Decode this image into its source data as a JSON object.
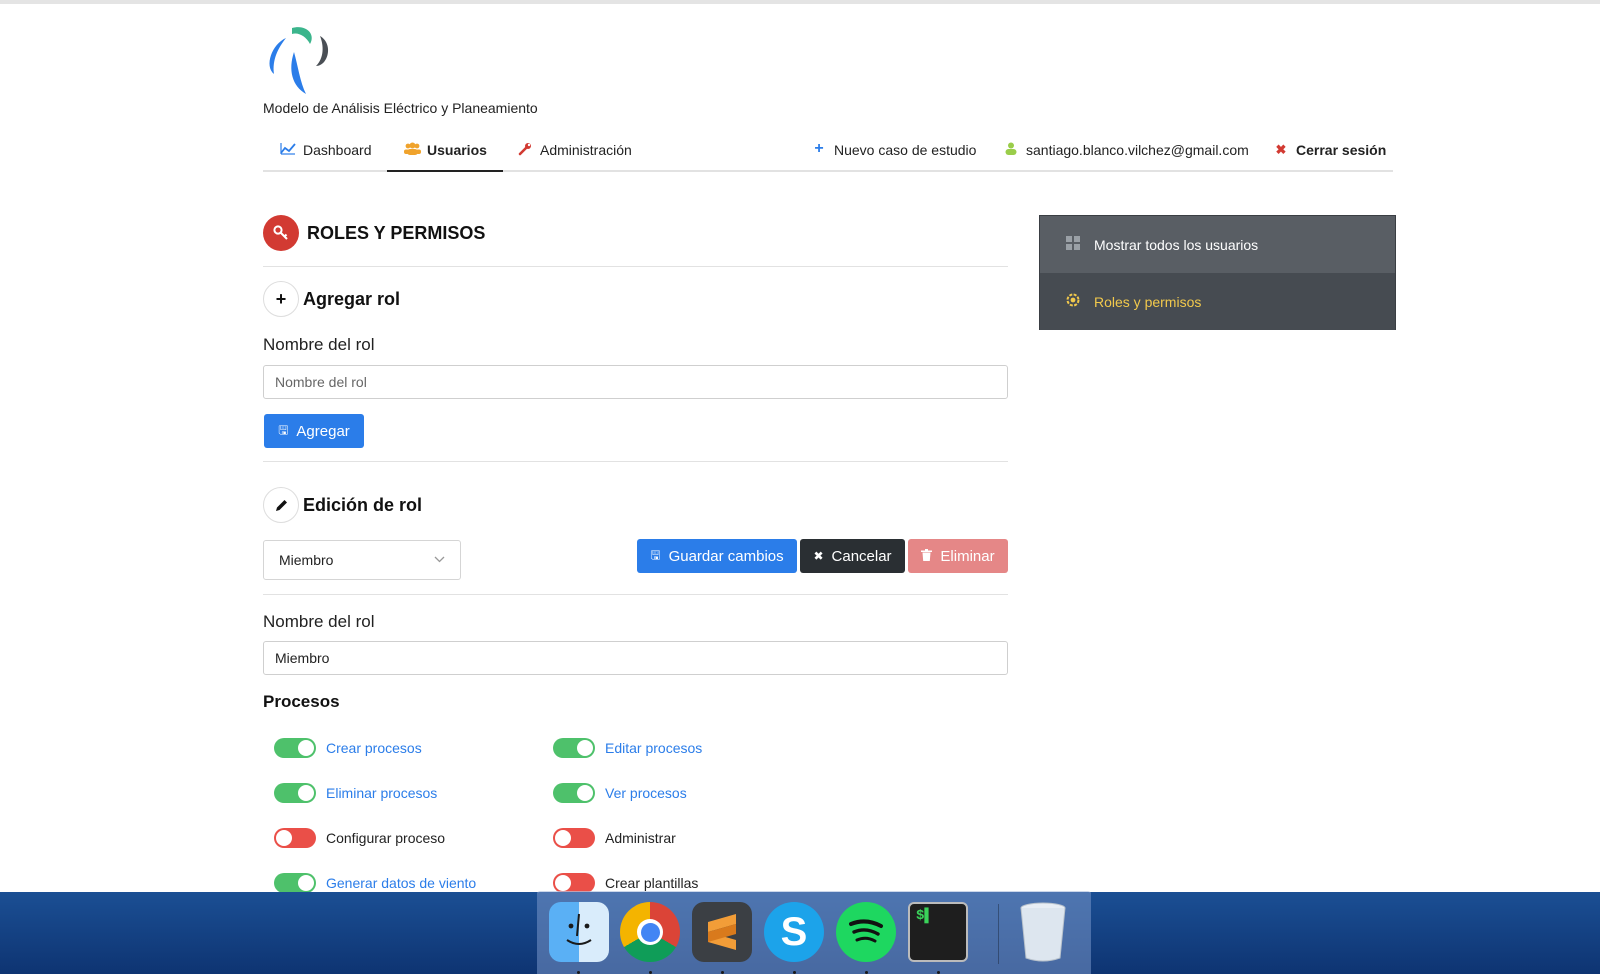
{
  "app": {
    "title": "Modelo de Análisis Eléctrico y Planeamiento"
  },
  "nav": {
    "dashboard": "Dashboard",
    "usuarios": "Usuarios",
    "administracion": "Administración",
    "nuevo_caso": "Nuevo caso de estudio",
    "user_email": "santiago.blanco.vilchez@gmail.com",
    "cerrar_sesion": "Cerrar sesión"
  },
  "page": {
    "title": "ROLES Y PERMISOS"
  },
  "add_role": {
    "heading": "Agregar rol",
    "label": "Nombre del rol",
    "placeholder": "Nombre del rol",
    "button": "Agregar"
  },
  "edit_role": {
    "heading": "Edición de rol",
    "selected_role": "Miembro",
    "save_button": "Guardar cambios",
    "cancel_button": "Cancelar",
    "delete_button": "Eliminar",
    "name_label": "Nombre del rol",
    "name_value": "Miembro"
  },
  "procesos": {
    "title": "Procesos",
    "permissions": [
      {
        "label": "Crear procesos",
        "enabled": true
      },
      {
        "label": "Editar procesos",
        "enabled": true
      },
      {
        "label": "Eliminar procesos",
        "enabled": true
      },
      {
        "label": "Ver procesos",
        "enabled": true
      },
      {
        "label": "Configurar proceso",
        "enabled": false
      },
      {
        "label": "Administrar",
        "enabled": false
      },
      {
        "label": "Generar datos de viento",
        "enabled": true
      },
      {
        "label": "Crear plantillas",
        "enabled": false
      }
    ]
  },
  "sidebar": {
    "items": [
      {
        "label": "Mostrar todos los usuarios",
        "icon": "grid-icon"
      },
      {
        "label": "Roles y permisos",
        "icon": "gear-icon"
      }
    ]
  },
  "colors": {
    "primary": "#2b7de9",
    "dark": "#2a2f33",
    "danger_light": "#e58787",
    "toggle_on": "#4ec16b",
    "toggle_off": "#ea4f48",
    "sidebar_active": "#f2c94c"
  },
  "dock": {
    "apps": [
      "finder-icon",
      "chrome-icon",
      "sublime-text-icon",
      "skype-icon",
      "spotify-icon",
      "terminal-icon",
      "trash-icon"
    ]
  }
}
